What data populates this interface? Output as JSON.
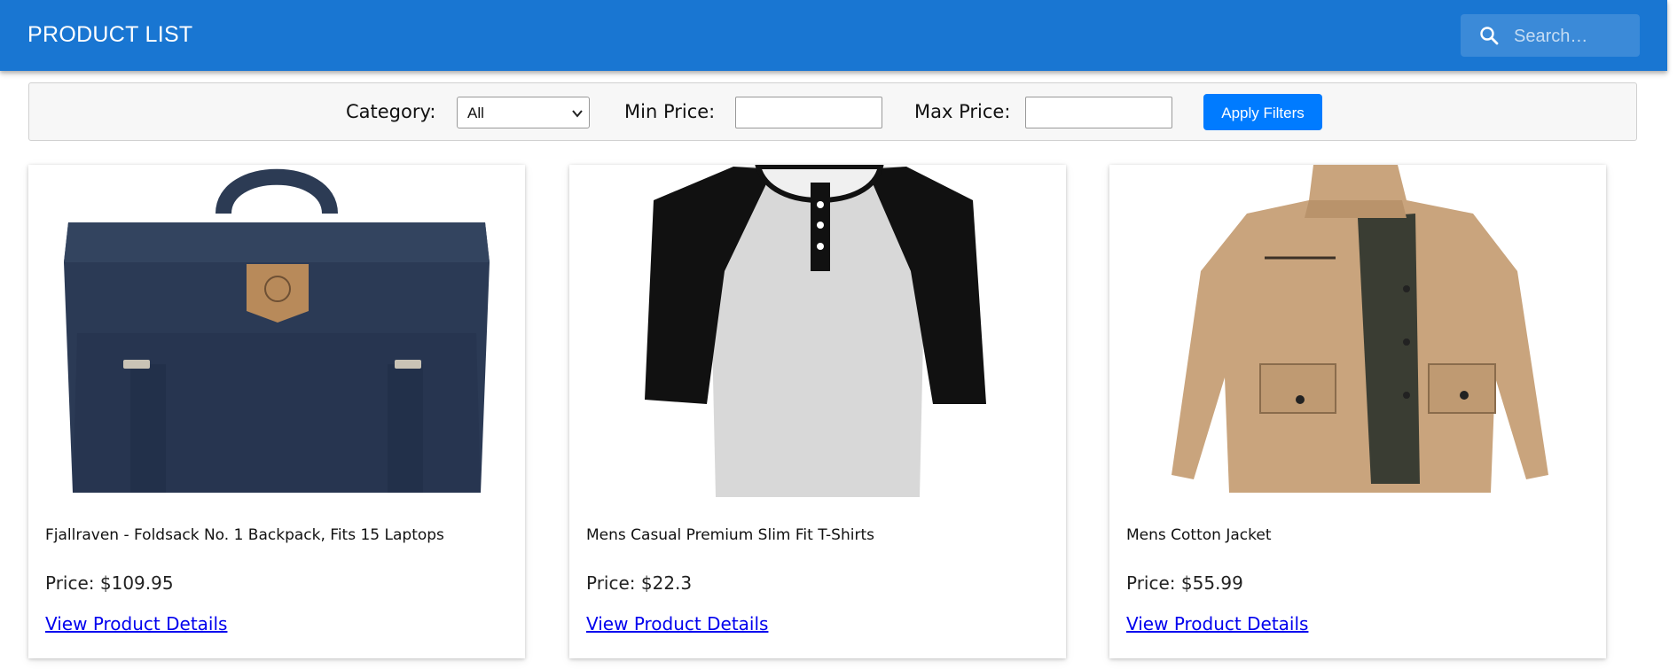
{
  "header": {
    "title": "PRODUCT LIST",
    "search": {
      "placeholder": "Search…",
      "value": "",
      "icon": "search-icon"
    },
    "background_color": "#1976d2"
  },
  "filters": {
    "category_label": "Category:",
    "category_value": "All",
    "min_price_label": "Min Price:",
    "min_price_value": "",
    "max_price_label": "Max Price:",
    "max_price_value": "",
    "apply_label": "Apply Filters",
    "apply_color": "#007bff"
  },
  "products": [
    {
      "title": "Fjallraven - Foldsack No. 1 Backpack, Fits 15 Laptops",
      "price": "Price: $109.95",
      "link": "View Product Details",
      "image": "backpack-image"
    },
    {
      "title": "Mens Casual Premium Slim Fit T-Shirts",
      "price": "Price: $22.3",
      "link": "View Product Details",
      "image": "raglan-tshirt-image"
    },
    {
      "title": "Mens Cotton Jacket",
      "price": "Price: $55.99",
      "link": "View Product Details",
      "image": "cotton-jacket-image"
    }
  ]
}
